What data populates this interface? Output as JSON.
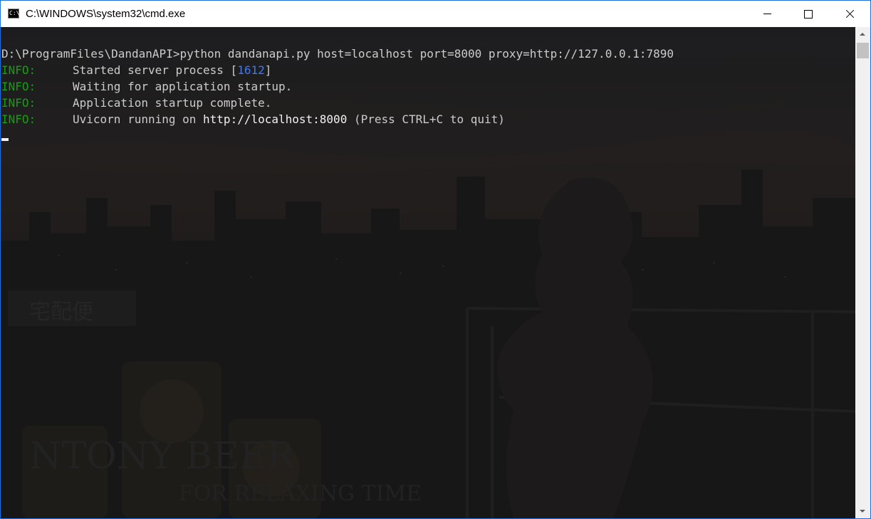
{
  "window": {
    "title": "C:\\WINDOWS\\system32\\cmd.exe",
    "icon": "cmd-icon",
    "icon_glyph": "C:\\",
    "border_color": "#1e6fd9",
    "controls": [
      "minimize-icon",
      "maximize-icon",
      "close-icon"
    ]
  },
  "console": {
    "background_color": "#151515",
    "text_color": "#cccccc",
    "info_color": "#13a10e",
    "number_color": "#3b78ff",
    "command": {
      "prompt": "D:\\ProgramFiles\\DandanAPI>",
      "text": "python dandanapi.py host=localhost port=8000 proxy=http://127.0.0.1:7890"
    },
    "logs": [
      {
        "level": "INFO:",
        "message": "Started server process [",
        "pid": "1612",
        "message_end": "]"
      },
      {
        "level": "INFO:",
        "message": "Waiting for application startup."
      },
      {
        "level": "INFO:",
        "message": "Application startup complete."
      },
      {
        "level": "INFO:",
        "message": "Uvicorn running on ",
        "url": "http://localhost:8000",
        "message_end": " (Press CTRL+C to quit)"
      }
    ],
    "wallpaper_text": [
      "宅配便",
      "NTONY BEER",
      "FOR RELAXING TIME"
    ]
  },
  "scrollbar": {
    "up": "chevron-up-icon",
    "down": "chevron-down-icon"
  }
}
